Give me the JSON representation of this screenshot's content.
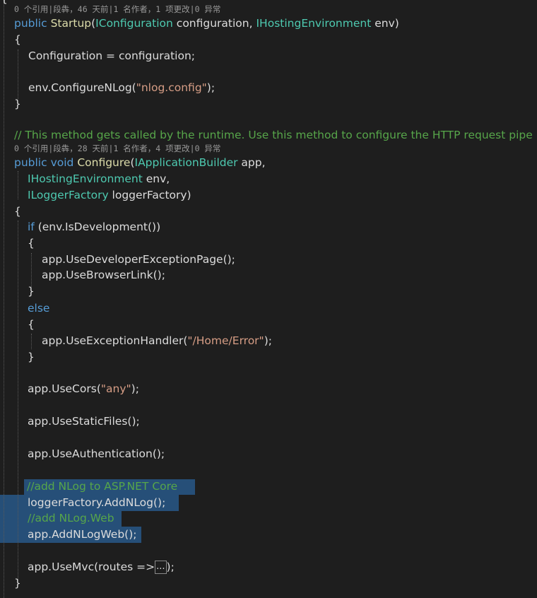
{
  "code_lens": {
    "startup_ctor": "0 个引用|段犇，46 天前|1 名作者，1 项更改|0 异常",
    "configure_method": "0 个引用|段犇，28 天前|1 名作者，4 项更改|0 异常"
  },
  "code": {
    "l_top_brace": "{",
    "ctor_kw": "public",
    "ctor_name": "Startup",
    "ctor_p1_type": "IConfiguration",
    "ctor_p1_name": " configuration, ",
    "ctor_p2_type": "IHostingEnvironment",
    "ctor_p2_name": " env)",
    "open1": "{",
    "assign": "Configuration = configuration;",
    "nlog_call_pre": "env.ConfigureNLog(",
    "nlog_call_str": "\"nlog.config\"",
    "nlog_call_post": ");",
    "close1": "}",
    "comment_runtime": "// This method gets called by the runtime. Use this method to configure the HTTP request pipe",
    "m_kw": "public void",
    "m_name": "Configure",
    "m_p1_type": "IApplicationBuilder",
    "m_p1_name": " app,",
    "m_p2_type": "IHostingEnvironment",
    "m_p2_name": " env,",
    "m_p3_type": "ILoggerFactory",
    "m_p3_name": " loggerFactory)",
    "open2": "{",
    "if_kw": "if",
    "if_cond": " (env.IsDevelopment())",
    "open3": "{",
    "use_dev_page": "app.UseDeveloperExceptionPage();",
    "use_browser_link": "app.UseBrowserLink();",
    "close3": "}",
    "else_kw": "else",
    "open4": "{",
    "use_ex_pre": "app.UseExceptionHandler(",
    "use_ex_str": "\"/Home/Error\"",
    "use_ex_post": ");",
    "close4": "}",
    "use_cors_pre": "app.UseCors(",
    "use_cors_str": "\"any\"",
    "use_cors_post": ");",
    "use_static": "app.UseStaticFiles();",
    "use_auth": "app.UseAuthentication();",
    "comment_add_nlog": "//add NLog to ASP.NET Core",
    "add_nlog": "loggerFactory.AddNLog();",
    "comment_add_nlog_web": "//add NLog.Web",
    "add_nlog_web": "app.AddNLogWeb();",
    "use_mvc_pre": "app.UseMvc(routes =>",
    "use_mvc_collapsed": "...",
    "use_mvc_post": ");",
    "close2": "}"
  },
  "colors": {
    "background": "#1e1e1e",
    "keyword": "#569cd6",
    "type": "#4ec9b0",
    "string": "#d69d85",
    "comment": "#57a64a",
    "text": "#dcdcdc",
    "selection": "#264f78"
  }
}
